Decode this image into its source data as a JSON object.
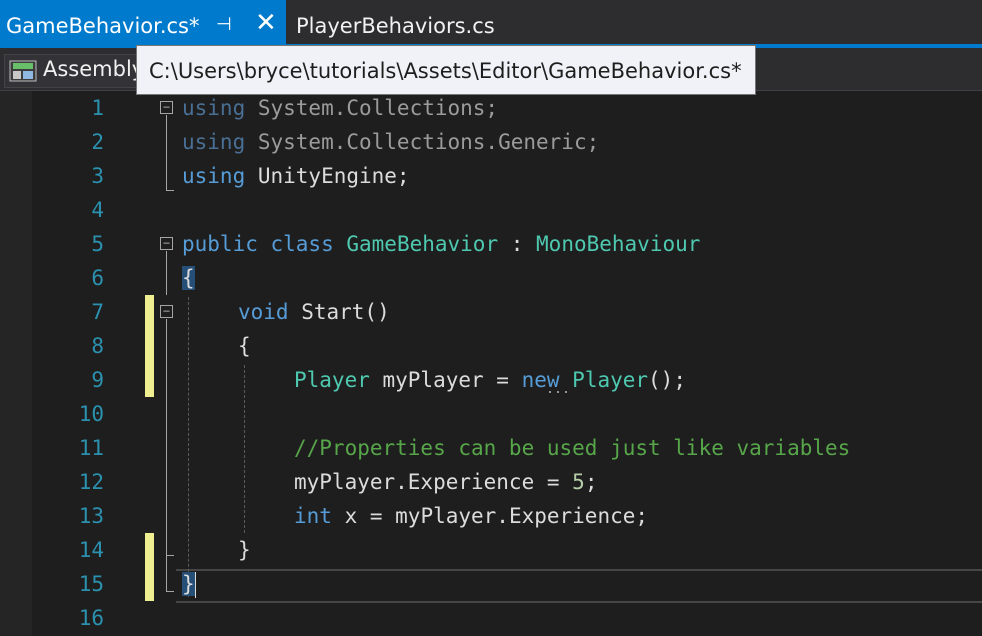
{
  "tabs": [
    {
      "label": "GameBehavior.cs*",
      "active": true,
      "pin_icon": "pin-icon",
      "close_icon": "close-icon"
    },
    {
      "label": "PlayerBehaviors.cs",
      "active": false
    }
  ],
  "navbar": {
    "project_label": "Assembly",
    "project_icon": "csharp-project-icon"
  },
  "tooltip": {
    "text": "C:\\Users\\bryce\\tutorials\\Assets\\Editor\\GameBehavior.cs*"
  },
  "editor": {
    "line_numbers": [
      "1",
      "2",
      "3",
      "4",
      "5",
      "6",
      "7",
      "8",
      "9",
      "10",
      "11",
      "12",
      "13",
      "14",
      "15",
      "16"
    ],
    "tokens": {
      "l1_kw": "using",
      "l1_ns": " System.Collections;",
      "l2_kw": "using",
      "l2_ns": " System.Collections.Generic;",
      "l3_kw": "using",
      "l3_ns": " UnityEngine;",
      "l5_kw1": "public",
      "l5_kw2": " class ",
      "l5_cls": "GameBehavior",
      "l5_colon": " : ",
      "l5_base": "MonoBehaviour",
      "l6_brace": "{",
      "l7_kw": "void",
      "l7_name": " Start()",
      "l8_brace": "{",
      "l9_type": "Player",
      "l9_var": " myPlayer = ",
      "l9_new": "new",
      "l9_space": " ",
      "l9_type2": "Player",
      "l9_end": "();",
      "l11_comment": "//Properties can be used just like variables",
      "l12_lhs": "myPlayer.Experience = ",
      "l12_num": "5",
      "l12_end": ";",
      "l13_kw": "int",
      "l13_rest": " x = myPlayer.Experience;",
      "l14_brace": "}",
      "l15_brace": "}"
    },
    "colors": {
      "keyword": "#569cd6",
      "type": "#4ec9b0",
      "comment": "#57a64a",
      "number": "#b5cea8",
      "line_number": "#2b91af",
      "accent": "#007acc",
      "change_marker": "#efef91"
    }
  }
}
